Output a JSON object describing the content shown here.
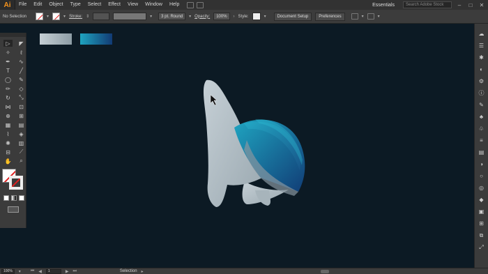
{
  "app": {
    "logo": "Ai"
  },
  "menu": [
    "File",
    "Edit",
    "Object",
    "Type",
    "Select",
    "Effect",
    "View",
    "Window",
    "Help"
  ],
  "menu_right": {
    "workspace": "Essentials",
    "search_placeholder": "Search Adobe Stock",
    "minimize": "–",
    "maximize": "□",
    "close": "✕"
  },
  "control": {
    "selection": "No Selection",
    "stroke_label": "Stroke:",
    "brush": "3 pt. Round",
    "opacity_label": "Opacity:",
    "opacity_value": "100%",
    "style_label": "Style:",
    "doc_setup": "Document Setup",
    "preferences": "Preferences"
  },
  "tools": [
    {
      "name": "selection-tool-icon",
      "glyph": "▷"
    },
    {
      "name": "direct-selection-tool-icon",
      "glyph": "◤"
    },
    {
      "name": "magic-wand-tool-icon",
      "glyph": "✧"
    },
    {
      "name": "lasso-tool-icon",
      "glyph": "ℓ"
    },
    {
      "name": "pen-tool-icon",
      "glyph": "✒"
    },
    {
      "name": "curvature-tool-icon",
      "glyph": "∿"
    },
    {
      "name": "type-tool-icon",
      "glyph": "T"
    },
    {
      "name": "line-tool-icon",
      "glyph": "╱"
    },
    {
      "name": "ellipse-tool-icon",
      "glyph": "◯"
    },
    {
      "name": "paintbrush-tool-icon",
      "glyph": "✎"
    },
    {
      "name": "pencil-tool-icon",
      "glyph": "✏"
    },
    {
      "name": "eraser-tool-icon",
      "glyph": "◇"
    },
    {
      "name": "rotate-tool-icon",
      "glyph": "↻"
    },
    {
      "name": "scale-tool-icon",
      "glyph": "⤡"
    },
    {
      "name": "width-tool-icon",
      "glyph": "⋈"
    },
    {
      "name": "free-transform-tool-icon",
      "glyph": "⊡"
    },
    {
      "name": "shape-builder-tool-icon",
      "glyph": "⊕"
    },
    {
      "name": "perspective-grid-tool-icon",
      "glyph": "⊞"
    },
    {
      "name": "mesh-tool-icon",
      "glyph": "▦"
    },
    {
      "name": "gradient-tool-icon",
      "glyph": "▤"
    },
    {
      "name": "eyedropper-tool-icon",
      "glyph": "⌇"
    },
    {
      "name": "blend-tool-icon",
      "glyph": "◈"
    },
    {
      "name": "symbol-sprayer-tool-icon",
      "glyph": "✺"
    },
    {
      "name": "column-graph-tool-icon",
      "glyph": "▥"
    },
    {
      "name": "artboard-tool-icon",
      "glyph": "⊟"
    },
    {
      "name": "slice-tool-icon",
      "glyph": "⟋"
    },
    {
      "name": "hand-tool-icon",
      "glyph": "✋"
    },
    {
      "name": "zoom-tool-icon",
      "glyph": "⌕"
    }
  ],
  "right_icons": [
    "libraries-icon",
    "properties-icon",
    "cc-icon",
    "color-guide-icon",
    "gear-icon",
    "info-icon",
    "brushes-icon",
    "symbols-icon",
    "club-icon",
    "stroke-icon",
    "gradient-icon",
    "transparency-icon",
    "appearance-icon",
    "graphic-styles-icon",
    "layers-icon",
    "artboards-icon",
    "align-icon",
    "pathfinder-icon",
    "transform-icon"
  ],
  "status": {
    "zoom": "100%",
    "artboard": "1",
    "tool": "Selection"
  },
  "colors": {
    "canvas": "#0c1a24",
    "chrome": "#3b3b3b",
    "menubar": "#323232",
    "accent_logo": "#f7941d"
  }
}
